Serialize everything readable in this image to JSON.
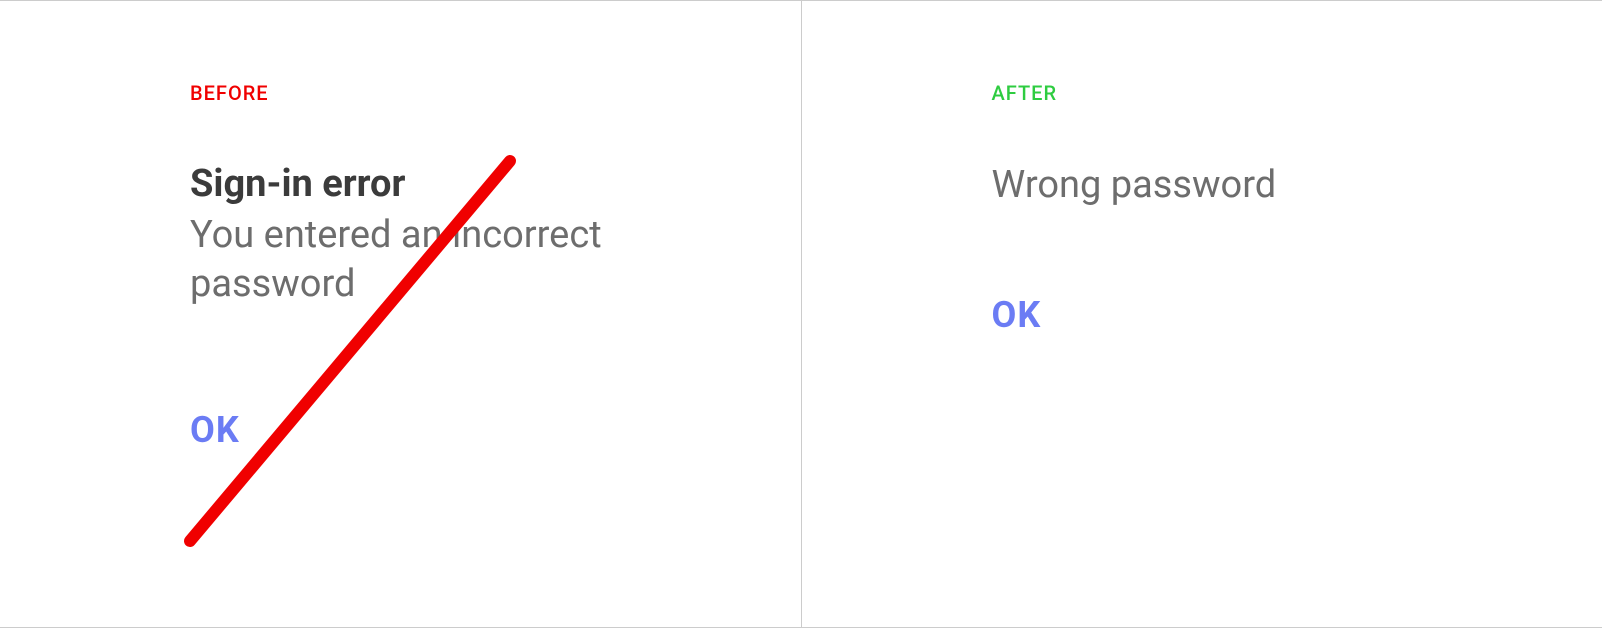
{
  "before": {
    "label": "BEFORE",
    "title": "Sign-in error",
    "body": "You entered an incorrect password",
    "ok": "OK"
  },
  "after": {
    "label": "AFTER",
    "title": "Wrong password",
    "ok": "OK"
  },
  "colors": {
    "before_label": "#f00000",
    "after_label": "#2ecc40",
    "ok": "#6b7cf4",
    "strike": "#f00000"
  }
}
